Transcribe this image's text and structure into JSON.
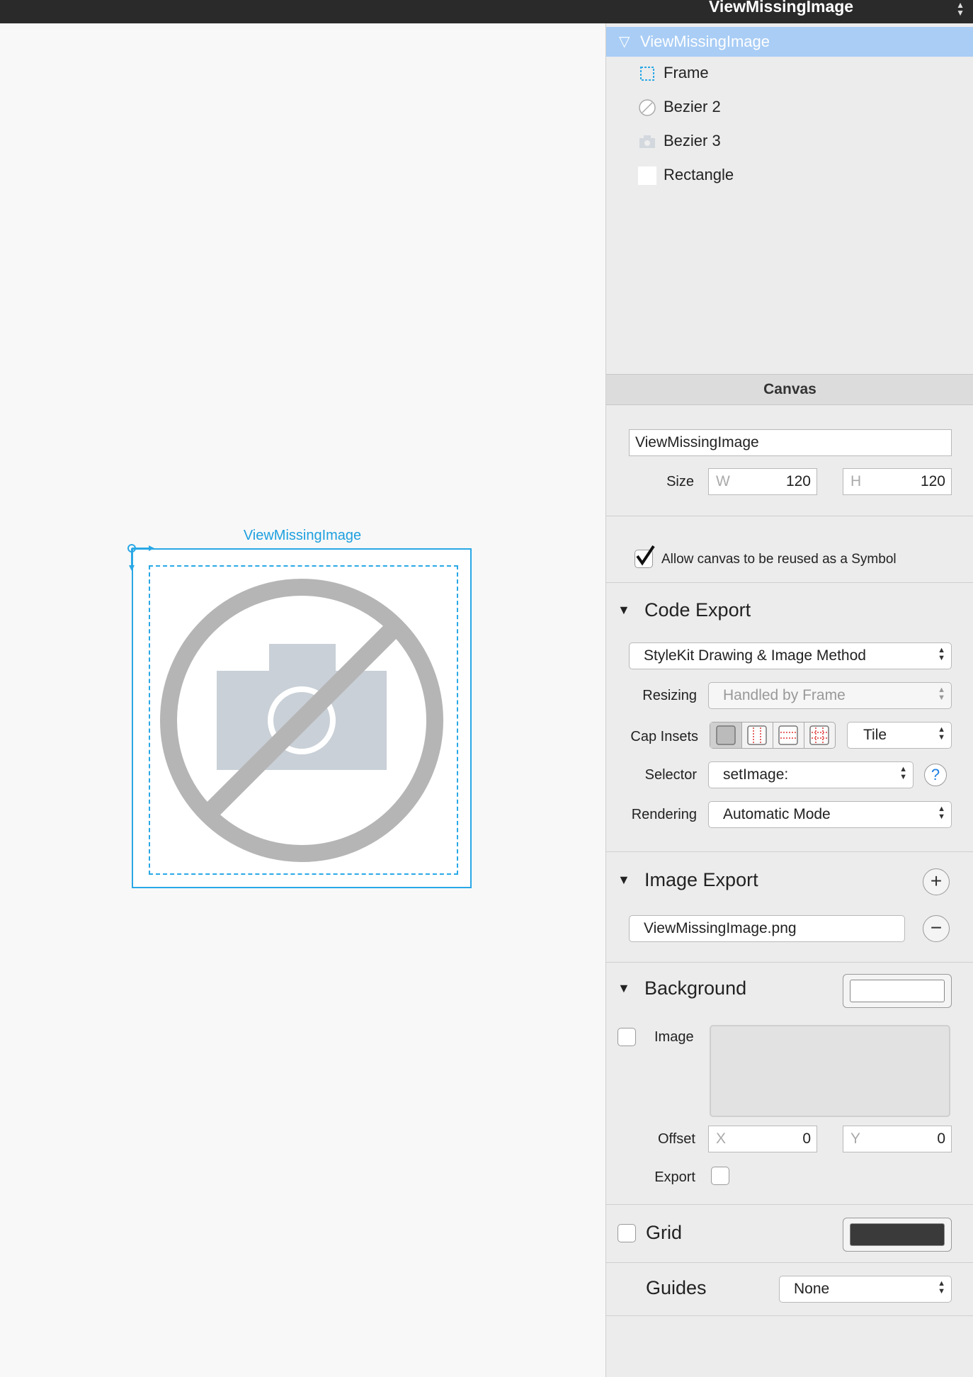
{
  "window": {
    "title": "ViewMissingImage"
  },
  "canvas": {
    "artboard_label": "ViewMissingImage"
  },
  "layers": {
    "root": "ViewMissingImage",
    "items": [
      {
        "label": "Frame",
        "icon": "frame-icon"
      },
      {
        "label": "Bezier 2",
        "icon": "bezier-slash-icon"
      },
      {
        "label": "Bezier 3",
        "icon": "camera-icon"
      },
      {
        "label": "Rectangle",
        "icon": "rectangle-icon"
      }
    ]
  },
  "inspector": {
    "section_title": "Canvas",
    "name_value": "ViewMissingImage",
    "size": {
      "label": "Size",
      "w_label": "W",
      "w_value": "120",
      "h_label": "H",
      "h_value": "120"
    },
    "symbol": {
      "label": "Allow canvas to be reused as a Symbol",
      "checked": true
    },
    "code_export": {
      "title": "Code Export",
      "method": "StyleKit Drawing & Image Method",
      "resizing_label": "Resizing",
      "resizing_value": "Handled by Frame",
      "cap_insets_label": "Cap Insets",
      "cap_mode": "Tile",
      "selector_label": "Selector",
      "selector_value": "setImage:",
      "help": "?",
      "rendering_label": "Rendering",
      "rendering_value": "Automatic Mode"
    },
    "image_export": {
      "title": "Image Export",
      "add": "+",
      "remove": "−",
      "file": "ViewMissingImage.png"
    },
    "background": {
      "title": "Background",
      "image_label": "Image",
      "offset_label": "Offset",
      "x_label": "X",
      "x_value": "0",
      "y_label": "Y",
      "y_value": "0",
      "export_label": "Export",
      "swatch_color": "#ffffff"
    },
    "grid": {
      "title": "Grid",
      "swatch_color": "#3a3a3a"
    },
    "guides": {
      "title": "Guides",
      "value": "None"
    }
  }
}
